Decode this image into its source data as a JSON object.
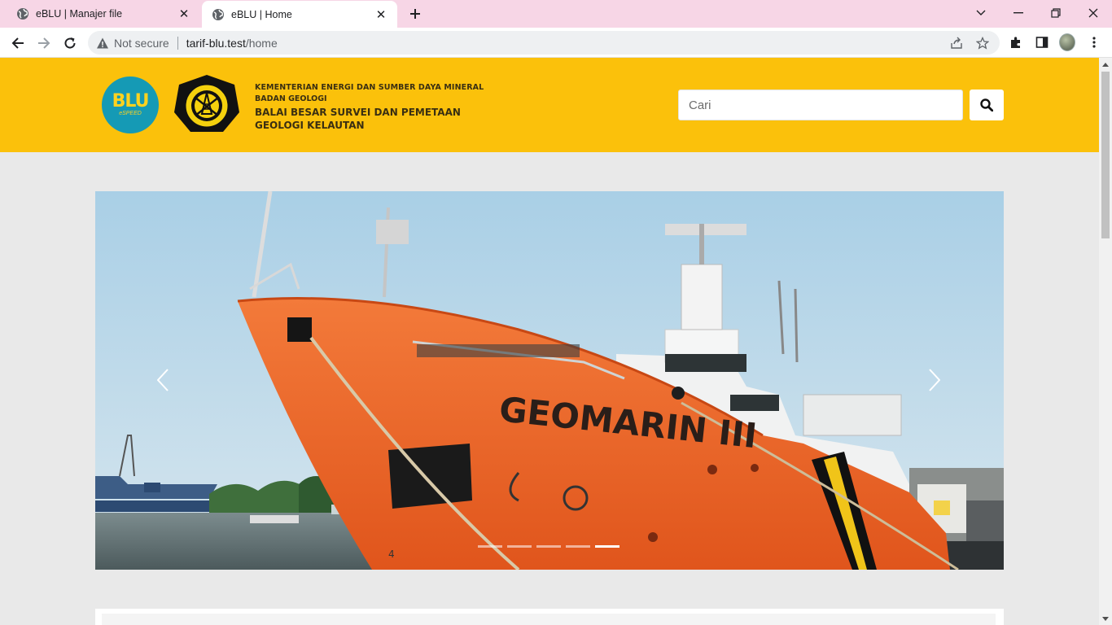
{
  "browser": {
    "tabs": [
      {
        "title": "eBLU | Manajer file",
        "active": false
      },
      {
        "title": "eBLU | Home",
        "active": true
      }
    ],
    "address": {
      "security_label": "Not secure",
      "host": "tarif-blu.test",
      "path": "/home"
    }
  },
  "header": {
    "logo_text": "BLU",
    "logo_subtext": "eSPEED",
    "org_ministry": "KEMENTERIAN ENERGI DAN SUMBER DAYA MINERAL",
    "org_agency": "BADAN GEOLOGI",
    "org_name_line1": "BALAI BESAR SURVEI DAN PEMETAAN",
    "org_name_line2": "GEOLOGI KELAUTAN",
    "search": {
      "placeholder": "Cari",
      "value": ""
    }
  },
  "carousel": {
    "slide_caption": "GEOMARIN III",
    "indicator_count": 5,
    "active_index": 4
  },
  "colors": {
    "header_bg": "#fbc10b",
    "tabbar_bg": "#f7d6e6",
    "page_bg": "#e9e9e9",
    "blu_logo_bg": "#159ab5",
    "ship_hull": "#f0652a"
  }
}
